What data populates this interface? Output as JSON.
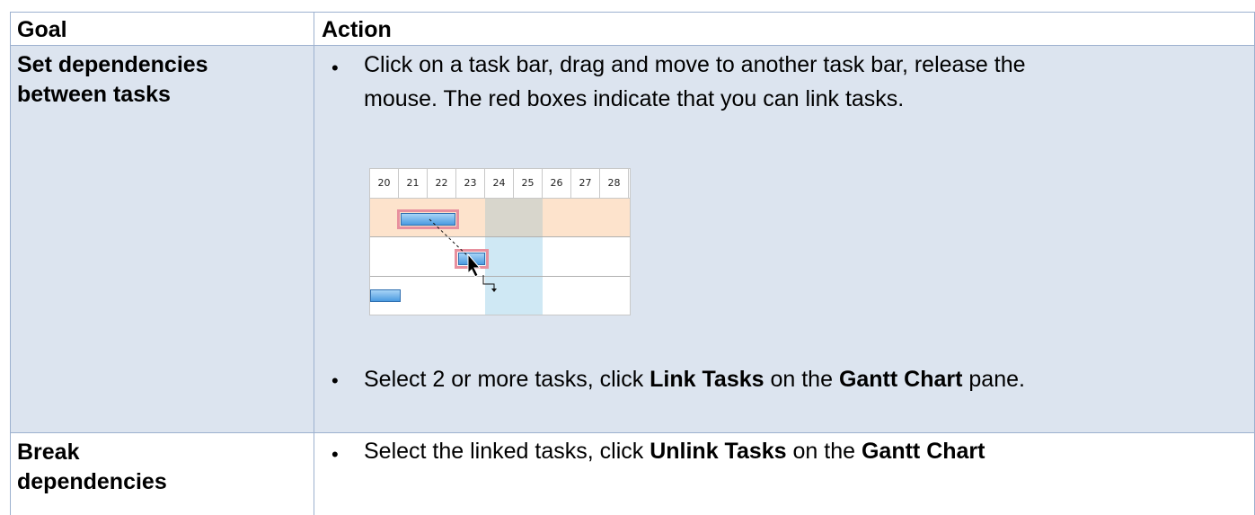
{
  "table": {
    "header": {
      "goal": "Goal",
      "action": "Action"
    },
    "rows": [
      {
        "goal_line1": "Set dependencies",
        "goal_line2": "between tasks",
        "action1_line1": "Click on a task bar, drag and move to another task bar, release the",
        "action1_line2": "mouse. The red boxes indicate that you can link tasks.",
        "action2_prefix": "Select 2 or more tasks, click ",
        "action2_bold1": "Link Tasks",
        "action2_mid": " on the ",
        "action2_bold2": "Gantt Chart",
        "action2_suffix": " pane."
      },
      {
        "goal_line1": "Break",
        "goal_line2": "dependencies",
        "action1_prefix": "Select the linked tasks, click ",
        "action1_bold1": "Unlink Tasks",
        "action1_mid": " on the ",
        "action1_bold2": "Gantt Chart"
      }
    ]
  },
  "gantt": {
    "days": [
      "20",
      "21",
      "22",
      "23",
      "24",
      "25",
      "26",
      "27",
      "28"
    ],
    "colors": {
      "row_highlight": "#fde3cc",
      "weekend": "#d8d6cc",
      "weekend_light": "#cfe8f4",
      "link_box": "#e7909e",
      "bar": "#4b9be0"
    }
  },
  "bullet_char": "•"
}
